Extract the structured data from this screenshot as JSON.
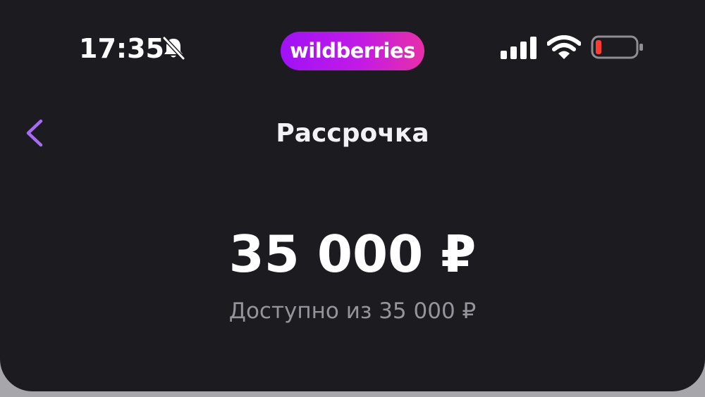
{
  "status_bar": {
    "time": "17:35",
    "silent_icon": "bell-slash-icon",
    "signal_icon": "cellular-signal-icon",
    "wifi_icon": "wifi-icon",
    "battery_icon": "battery-low-icon",
    "battery_level": 0.1,
    "battery_color": "#ff3b30"
  },
  "brand": {
    "name": "wildberries",
    "gradient_start": "#a012f7",
    "gradient_end": "#e82fa8"
  },
  "header": {
    "back_icon": "chevron-left-icon",
    "back_color": "#a66af5",
    "title": "Рассрочка"
  },
  "main": {
    "amount": "35 000 ₽",
    "available_text": "Доступно из 35 000 ₽"
  },
  "colors": {
    "background": "#1c1b20",
    "secondary_text": "#95949c"
  }
}
